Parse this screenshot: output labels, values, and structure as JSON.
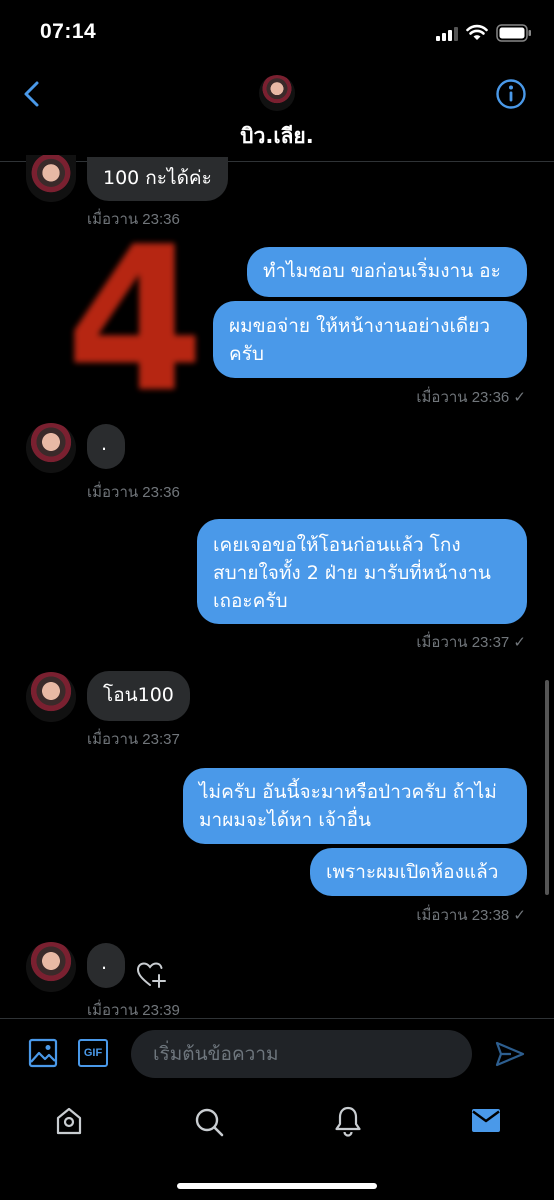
{
  "status_bar": {
    "time": "07:14"
  },
  "header": {
    "title": "บิว.เลีย."
  },
  "messages": {
    "m1": {
      "text": "100 กะได้ค่ะ",
      "time": "เมื่อวาน 23:36"
    },
    "m2a": {
      "text": "ทำไมชอบ ขอก่อนเริ่มงาน อะ"
    },
    "m2b": {
      "line1": "ผมขอจ่าย ให้หน้างานอย่างเดียว",
      "line2": "ครับ",
      "time": "เมื่อวาน 23:36 ✓"
    },
    "m3": {
      "text": ".",
      "time": "เมื่อวาน 23:36"
    },
    "m4": {
      "line1": "เคยเจอขอให้โอนก่อนแล้ว โกง",
      "line2": "สบายใจทั้ง 2 ฝ่าย มารับที่หน้างาน",
      "line3": "เถอะครับ",
      "time": "เมื่อวาน 23:37 ✓"
    },
    "m5": {
      "text": "โอน100",
      "time": "เมื่อวาน 23:37"
    },
    "m6a": {
      "line1": "ไม่ครับ อันนี้จะมาหรือป่าวครับ ถ้าไม่",
      "line2": "มาผมจะได้หา เจ้าอื่น"
    },
    "m6b": {
      "text": "เพราะผมเปิดห้องแล้ว",
      "time": "เมื่อวาน 23:38 ✓"
    },
    "m7": {
      "text": ".",
      "time": "เมื่อวาน 23:39"
    }
  },
  "sticker": {
    "text": "4",
    "color": "#c62a14"
  },
  "composer": {
    "placeholder": "เริ่มต้นข้อความ",
    "gif_label": "GIF"
  },
  "colors": {
    "accent": "#4a99e9",
    "incoming": "#2a2c2e",
    "timestamp": "#71767b"
  },
  "icons": [
    "back-chevron-icon",
    "info-icon",
    "image-icon",
    "gif-icon",
    "send-icon",
    "heart-plus-icon",
    "home-icon",
    "search-icon",
    "bell-icon",
    "mail-icon"
  ]
}
